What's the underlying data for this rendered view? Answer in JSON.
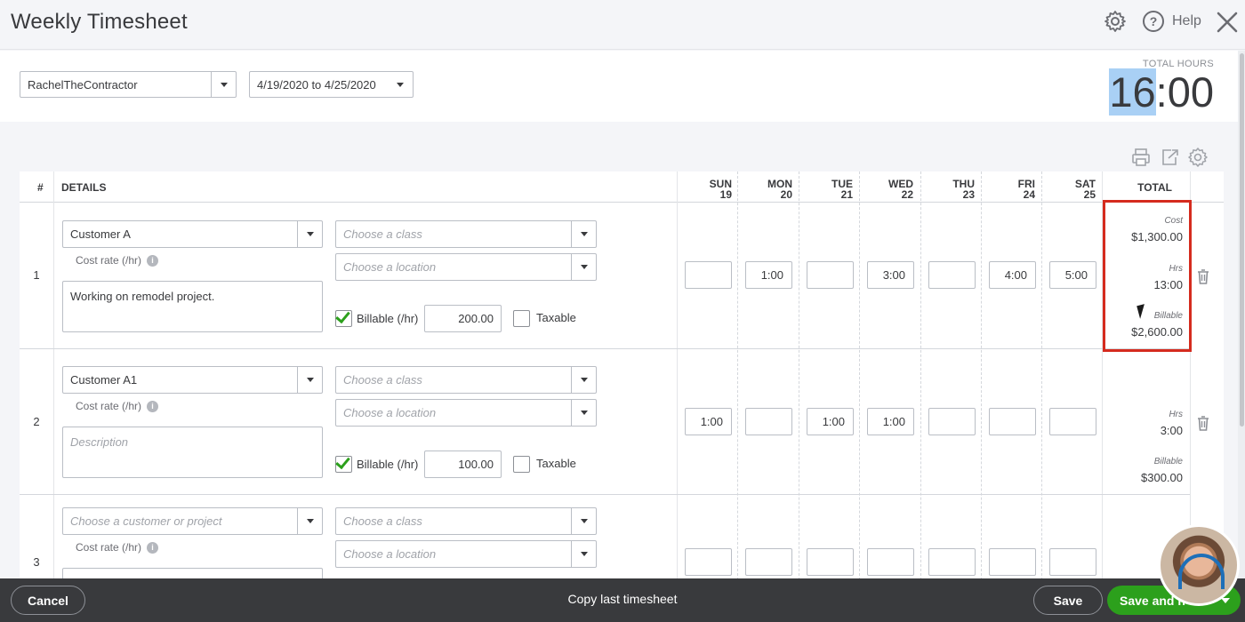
{
  "header": {
    "title": "Weekly Timesheet",
    "help_label": "Help"
  },
  "filters": {
    "employee": "RachelTheContractor",
    "date_range": "4/19/2020 to 4/25/2020",
    "total_hours_label": "TOTAL HOURS",
    "total_hours_hh": "16",
    "total_hours_mm": ":00"
  },
  "table": {
    "headers": {
      "num": "#",
      "details": "DETAILS",
      "total": "TOTAL",
      "days": [
        {
          "day": "SUN",
          "date": "19"
        },
        {
          "day": "MON",
          "date": "20"
        },
        {
          "day": "TUE",
          "date": "21"
        },
        {
          "day": "WED",
          "date": "22"
        },
        {
          "day": "THU",
          "date": "23"
        },
        {
          "day": "FRI",
          "date": "24"
        },
        {
          "day": "SAT",
          "date": "25"
        }
      ]
    },
    "rows": [
      {
        "num": "1",
        "customer": "Customer A",
        "class_placeholder": "Choose a class",
        "location_placeholder": "Choose a location",
        "cost_rate_label": "Cost rate (/hr)",
        "description": "Working on remodel project.",
        "billable_label": "Billable (/hr)",
        "billable_checked": true,
        "rate": "200.00",
        "taxable_label": "Taxable",
        "hours": [
          "",
          "1:00",
          "",
          "3:00",
          "",
          "4:00",
          "5:00"
        ],
        "cost_label": "Cost",
        "cost": "$1,300.00",
        "hrs_label": "Hrs",
        "hrs": "13:00",
        "billable_sum_label": "Billable",
        "billable_sum": "$2,600.00"
      },
      {
        "num": "2",
        "customer": "Customer A1",
        "class_placeholder": "Choose a class",
        "location_placeholder": "Choose a location",
        "cost_rate_label": "Cost rate (/hr)",
        "description_placeholder": "Description",
        "billable_label": "Billable (/hr)",
        "billable_checked": true,
        "rate": "100.00",
        "taxable_label": "Taxable",
        "hours": [
          "1:00",
          "",
          "1:00",
          "1:00",
          "",
          "",
          ""
        ],
        "hrs_label": "Hrs",
        "hrs": "3:00",
        "billable_sum_label": "Billable",
        "billable_sum": "$300.00"
      },
      {
        "num": "3",
        "customer_placeholder": "Choose a customer or project",
        "class_placeholder": "Choose a class",
        "location_placeholder": "Choose a location",
        "cost_rate_label": "Cost rate (/hr)"
      }
    ]
  },
  "footer": {
    "cancel": "Cancel",
    "copy_last": "Copy last timesheet",
    "save": "Save",
    "save_and": "Save and n"
  },
  "colors": {
    "accent_green": "#2ca01c",
    "highlight_red": "#d52b1e",
    "footer_bg": "#393a3d",
    "selection_blue": "#a9d0f5"
  }
}
